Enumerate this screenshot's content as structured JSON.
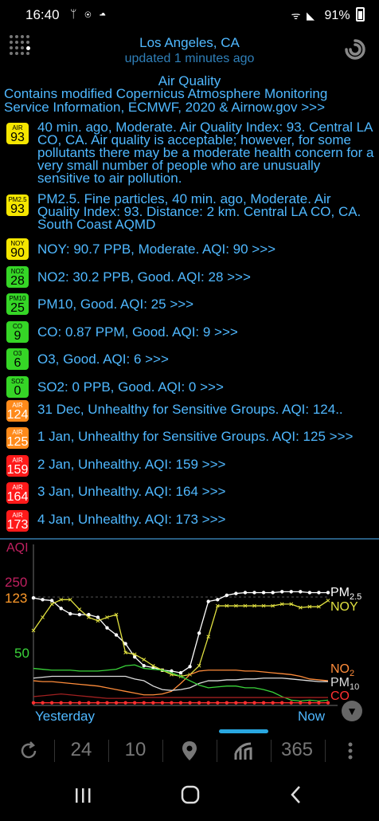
{
  "status_bar": {
    "time": "16:40",
    "left_icons": "ᛘ ◉ ☁",
    "signal": "ᯤ ◣",
    "battery": "91%"
  },
  "header": {
    "location": "Los Angeles, CA",
    "updated": "updated 1 minutes ago"
  },
  "air_quality": {
    "title": "Air Quality",
    "source": "Contains modified Copernicus Atmosphere Monitoring Service Information, ECMWF, 2020 & Airnow.gov >>>"
  },
  "readings": [
    {
      "badge_top": "AIR",
      "badge_val": "93",
      "color": "#f5e600",
      "text": "40 min. ago, Moderate. Air Quality Index: 93. Central LA CO, CA. Air quality is acceptable; however, for some pollutants there may be a moderate health concern for a very small number of people who are unusually sensitive to air pollution."
    },
    {
      "badge_top": "PM2.5",
      "badge_val": "93",
      "color": "#f5e600",
      "text": "PM2.5. Fine particles, 40 min. ago, Moderate. Air Quality Index: 93. Distance: 2 km. Central LA CO, CA. South Coast AQMD"
    },
    {
      "badge_top": "NOY",
      "badge_val": "90",
      "color": "#f5e600",
      "text": "NOY: 90.7 PPB, Moderate. AQI: 90 >>>"
    },
    {
      "badge_top": "NO2",
      "badge_val": "28",
      "color": "#35d626",
      "text": "NO2: 30.2 PPB, Good. AQI: 28 >>>"
    },
    {
      "badge_top": "PM10",
      "badge_val": "25",
      "color": "#35d626",
      "text": "PM10, Good. AQI: 25 >>>"
    },
    {
      "badge_top": "CO",
      "badge_val": "9",
      "color": "#35d626",
      "text": "CO: 0.87 PPM, Good. AQI: 9 >>>"
    },
    {
      "badge_top": "O3",
      "badge_val": "6",
      "color": "#35d626",
      "text": "O3, Good. AQI: 6 >>>"
    },
    {
      "badge_top": "SO2",
      "badge_val": "0",
      "color": "#35d626",
      "text": "SO2: 0 PPB, Good. AQI: 0 >>>"
    }
  ],
  "forecast": [
    {
      "badge_top": "AIR",
      "badge_val": "124",
      "color": "#ff8a1a",
      "text": "31 Dec, Unhealthy for Sensitive Groups. AQI: 124.."
    },
    {
      "badge_top": "AIR",
      "badge_val": "125",
      "color": "#ff8a1a",
      "text": "1 Jan, Unhealthy for Sensitive Groups. AQI: 125 >>>"
    },
    {
      "badge_top": "AIR",
      "badge_val": "159",
      "color": "#ff1a1a",
      "text": "2 Jan, Unhealthy. AQI: 159 >>>"
    },
    {
      "badge_top": "AIR",
      "badge_val": "164",
      "color": "#ff1a1a",
      "text": "3 Jan, Unhealthy. AQI: 164 >>>"
    },
    {
      "badge_top": "AIR",
      "badge_val": "173",
      "color": "#ff1a1a",
      "text": "4 Jan, Unhealthy. AQI: 173 >>>"
    }
  ],
  "chart_data": {
    "type": "line",
    "ylabel": "AQI",
    "y_ticks": [
      "250",
      "123",
      "50"
    ],
    "xlabel_left": "Yesterday",
    "xlabel_right": "Now",
    "ylim": [
      0,
      140
    ],
    "series": [
      {
        "name": "PM2.5",
        "color": "#ffffff",
        "marker": "dot",
        "values": [
          122,
          120,
          119,
          110,
          104,
          103,
          103,
          100,
          88,
          80,
          70,
          55,
          45,
          43,
          40,
          39,
          37,
          44,
          82,
          118,
          120,
          125,
          127,
          128,
          128,
          128,
          128,
          129,
          129,
          129,
          128,
          128,
          128
        ]
      },
      {
        "name": "NOY",
        "color": "#e0e040",
        "marker": "x",
        "values": [
          85,
          100,
          115,
          120,
          120,
          109,
          100,
          96,
          100,
          103,
          60,
          58,
          52,
          45,
          40,
          35,
          33,
          35,
          45,
          78,
          113,
          113,
          113,
          113,
          113,
          113,
          113,
          115,
          115,
          111,
          112,
          112,
          119
        ]
      },
      {
        "name": "NO2",
        "color": "#ff8c3a",
        "values": [
          28,
          27,
          27,
          26,
          25,
          24,
          23,
          22,
          20,
          18,
          16,
          14,
          12,
          12,
          13,
          16,
          25,
          35,
          39,
          40,
          40,
          40,
          40,
          39,
          39,
          38,
          37,
          36,
          35,
          33,
          30,
          29,
          28
        ]
      },
      {
        "name": "PM10",
        "color": "#dddddd",
        "values": [
          31,
          32,
          33,
          33,
          33,
          33,
          33,
          33,
          33,
          33,
          33,
          30,
          28,
          22,
          18,
          17,
          18,
          20,
          25,
          28,
          28,
          29,
          29,
          30,
          30,
          31,
          31,
          31,
          30,
          29,
          28,
          27,
          27
        ]
      },
      {
        "name": "green",
        "color": "#3ad43a",
        "values": [
          42,
          41,
          40,
          40,
          40,
          39,
          39,
          39,
          40,
          41,
          45,
          46,
          42,
          41,
          40,
          37,
          33,
          28,
          23,
          20,
          21,
          22,
          22,
          20,
          20,
          18,
          15,
          10,
          6,
          5,
          6,
          5,
          6
        ]
      },
      {
        "name": "CO",
        "color": "#ff3030",
        "marker": "dot",
        "values": [
          3,
          3,
          3,
          3,
          3,
          3,
          3,
          3,
          3,
          3,
          3,
          3,
          3,
          3,
          3,
          3,
          3,
          3,
          3,
          3,
          3,
          3,
          3,
          3,
          3,
          3,
          3,
          3,
          3,
          3,
          3,
          3,
          3
        ]
      },
      {
        "name": "red2",
        "color": "#a02020",
        "values": [
          10,
          11,
          12,
          13,
          12,
          11,
          10,
          9,
          8,
          8,
          8,
          8,
          9,
          9,
          9,
          9,
          9,
          9,
          9,
          9,
          9,
          9,
          9,
          9,
          9,
          9,
          9,
          9,
          9,
          9,
          9,
          9,
          9
        ]
      }
    ],
    "legend": [
      {
        "label": "PM2.5",
        "color": "#ffffff"
      },
      {
        "label": "NOY",
        "color": "#e0e040"
      },
      {
        "label": "NO2",
        "color": "#ff8c3a"
      },
      {
        "label": "PM10",
        "color": "#dddddd"
      },
      {
        "label": "CO",
        "color": "#ff3030"
      }
    ]
  },
  "toolbar": {
    "refresh_icon": "refresh-icon",
    "hours_24": "24",
    "days_10": "10",
    "location_icon": "map-pin-icon",
    "chart_icon": "chart-icon",
    "days_365": "365",
    "more_icon": "more-vert-icon",
    "accent": "#29a7e0"
  },
  "navbar": {
    "recents": "|||",
    "home": "○",
    "back": "‹"
  }
}
